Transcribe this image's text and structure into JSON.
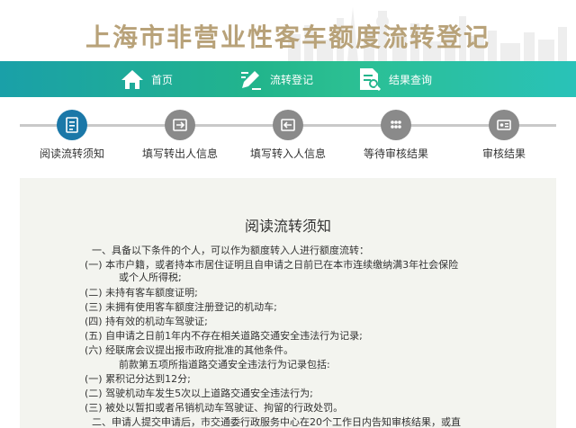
{
  "header": {
    "title": "上海市非营业性客车额度流转登记"
  },
  "nav": [
    {
      "label": "首页",
      "icon": "home-icon"
    },
    {
      "label": "流转登记",
      "icon": "pen-edit-icon"
    },
    {
      "label": "结果查询",
      "icon": "document-search-icon"
    }
  ],
  "steps": [
    {
      "label": "阅读流转须知",
      "icon": "notice-doc-icon",
      "active": true
    },
    {
      "label": "填写转出人信息",
      "icon": "transfer-out-icon",
      "active": false
    },
    {
      "label": "填写转入人信息",
      "icon": "transfer-in-icon",
      "active": false
    },
    {
      "label": "等待审核结果",
      "icon": "more-dots-icon",
      "active": false
    },
    {
      "label": "审核结果",
      "icon": "id-card-icon",
      "active": false
    }
  ],
  "content": {
    "title": "阅读流转须知",
    "lines": [
      "一、具备以下条件的个人，可以作为额度转入人进行额度流转：",
      "(一) 本市户籍，或者持本市居住证明且自申请之日前已在本市连续缴纳满3年社会保险",
      "或个人所得税;",
      "(二) 未持有客车额度证明;",
      "(三) 未拥有使用客车额度注册登记的机动车;",
      "(四) 持有效的机动车驾驶证;",
      "(五) 自申请之日前1年内不存在相关道路交通安全违法行为记录;",
      "(六) 经联席会议提出报市政府批准的其他条件。",
      "前款第五项所指道路交通安全违法行为记录包括:",
      "(一) 累积记分达到12分;",
      "(二) 驾驶机动车发生5次以上道路交通安全违法行为;",
      "(三) 被处以暂扣或者吊销机动车驾驶证、拘留的行政处罚。",
      "二、申请人提交申请后，市交通委行政服务中心在20个工作日内告知审核结果，或直"
    ]
  }
}
